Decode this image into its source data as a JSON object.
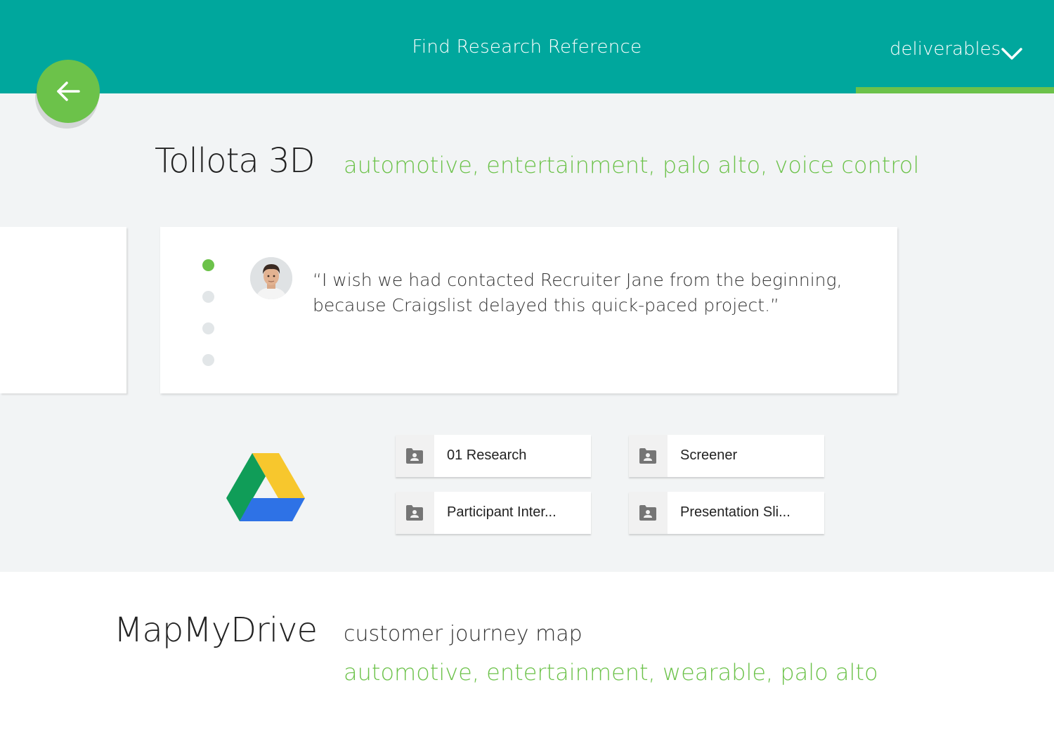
{
  "header": {
    "title": "Find Research Reference",
    "menu_label": "deliverables",
    "bg_color": "#00a79d",
    "accent_color": "#6cc24a"
  },
  "back_button": {
    "icon": "arrow-left-icon"
  },
  "project1": {
    "title": "Tollota 3D",
    "tags": "automotive, entertainment, palo alto, voice control",
    "quote": "“I wish we had contacted Recruiter Jane from the beginning, because Craigslist delayed this quick-paced project.”",
    "carousel": {
      "count": 4,
      "active_index": 0
    },
    "drive_icon": "google-drive-icon",
    "files": [
      {
        "name": "01 Research",
        "icon": "shared-folder-icon"
      },
      {
        "name": "Screener",
        "icon": "shared-folder-icon"
      },
      {
        "name": "Participant Inter...",
        "icon": "shared-folder-icon"
      },
      {
        "name": "Presentation Sli...",
        "icon": "shared-folder-icon"
      }
    ]
  },
  "project2": {
    "title": "MapMyDrive",
    "subtitle": "customer journey map",
    "tags": "automotive, entertainment, wearable, palo alto"
  }
}
